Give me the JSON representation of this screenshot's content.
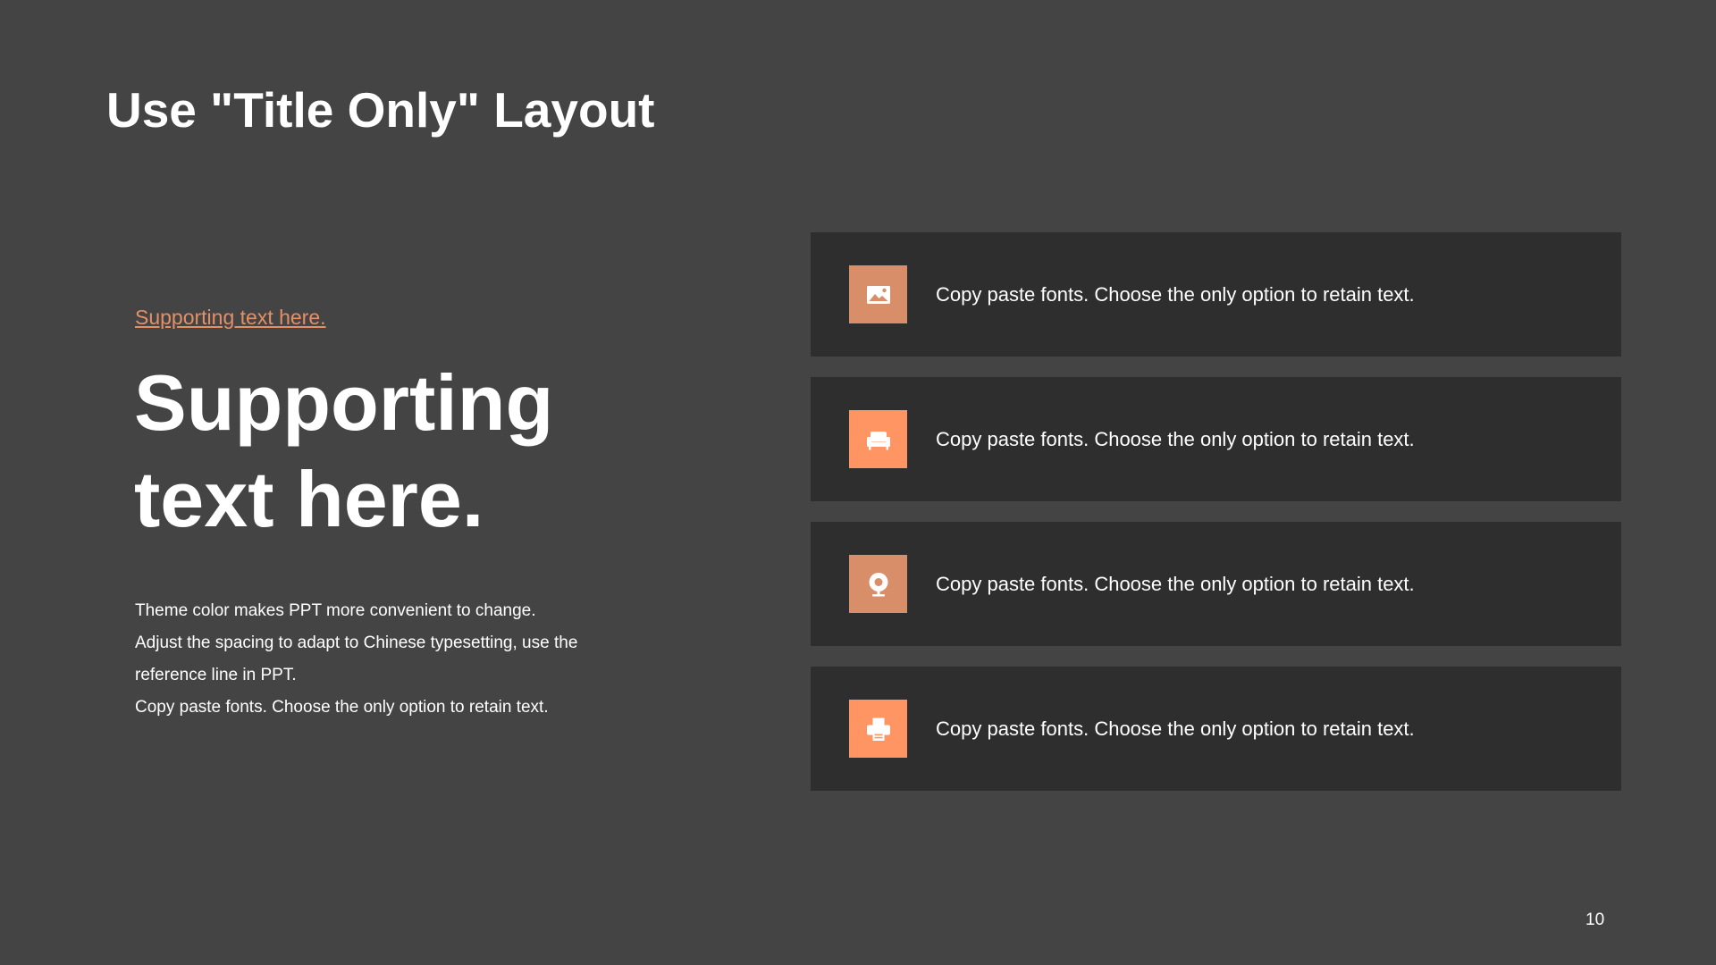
{
  "slide": {
    "title": "Use \"Title Only\" Layout",
    "kicker": "Supporting text here.",
    "headline": "Supporting text here.",
    "body": [
      "Theme color makes PPT more convenient  to change.",
      "Adjust the spacing to adapt to Chinese typesetting, use the",
      "reference line in PPT.",
      "Copy paste  fonts. Choose the only option to retain text."
    ],
    "page_number": "10"
  },
  "colors": {
    "background": "#444444",
    "card_background": "#2f2e2e",
    "accent": "#e58f66",
    "accent_light": "#ff9563",
    "accent_muted": "#d98e6a"
  },
  "cards": [
    {
      "icon": "image-icon",
      "color": "#d98e6a",
      "text": "Copy paste fonts. Choose the only option to retain text."
    },
    {
      "icon": "sofa-icon",
      "color": "#ff9563",
      "text": "Copy paste fonts. Choose the only option to retain text."
    },
    {
      "icon": "webcam-icon",
      "color": "#d98e6a",
      "text": "Copy paste fonts. Choose the only option to retain text."
    },
    {
      "icon": "printer-icon",
      "color": "#ff9563",
      "text": "Copy paste fonts. Choose the only option to retain text."
    }
  ]
}
